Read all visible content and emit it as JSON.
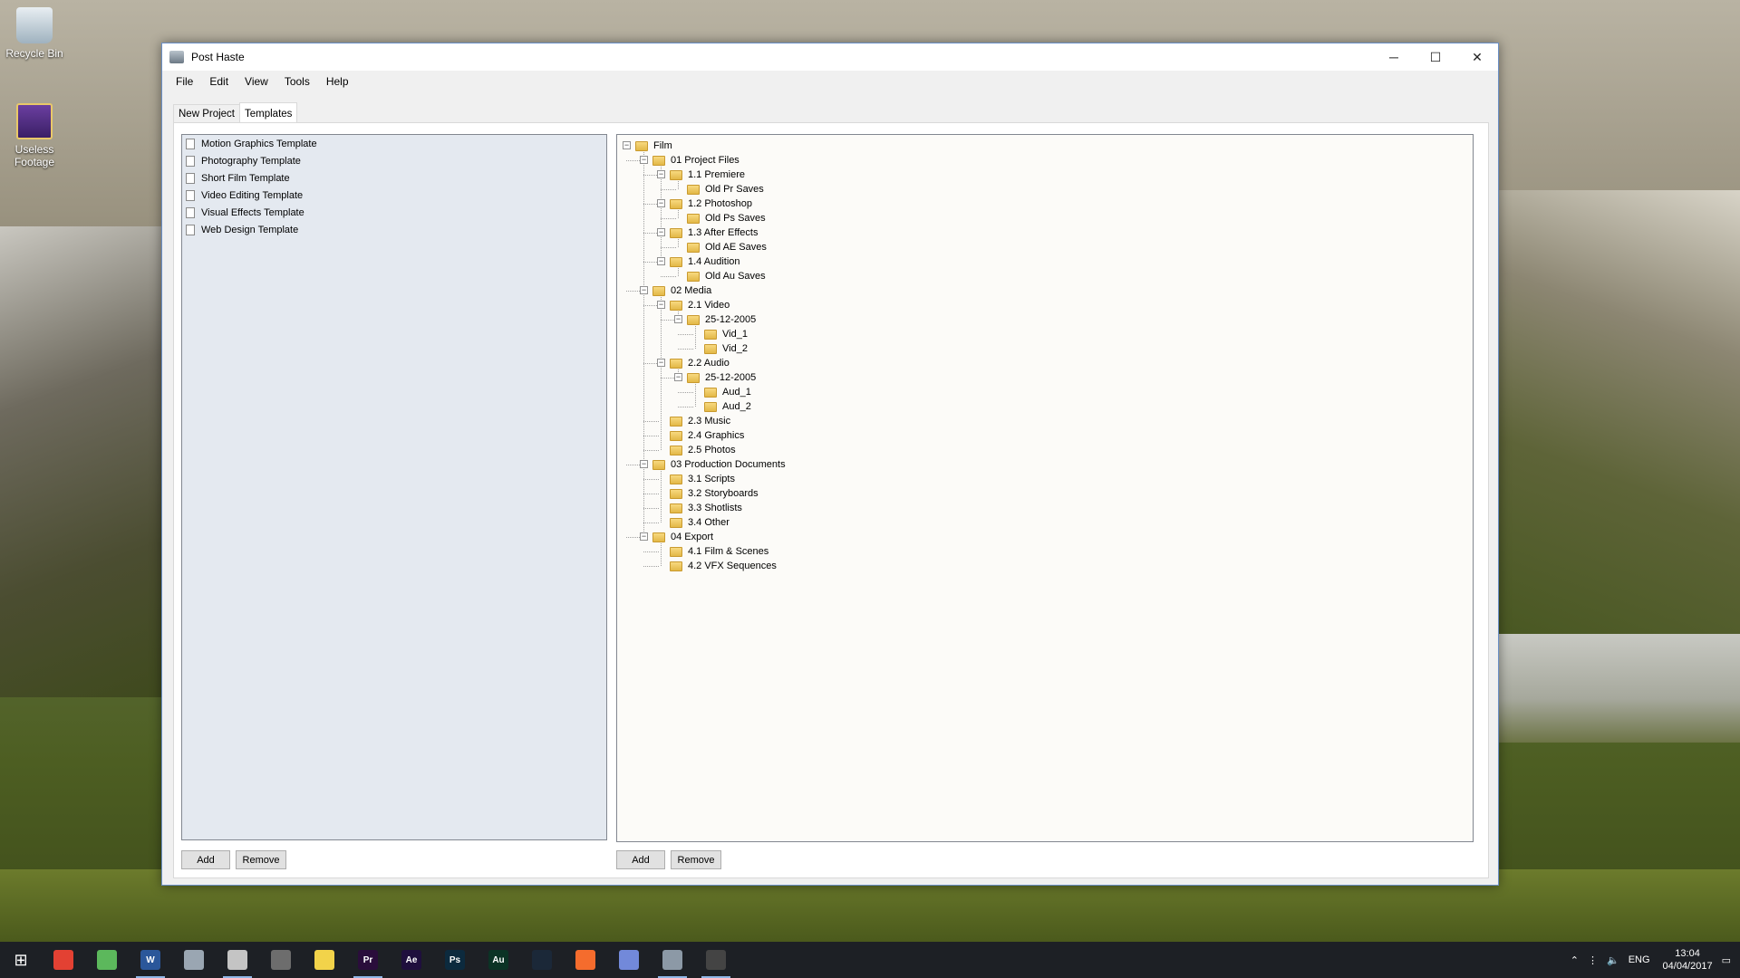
{
  "desktop": {
    "icons": [
      {
        "label": "Recycle Bin"
      },
      {
        "label": "Useless Footage"
      }
    ]
  },
  "window": {
    "title": "Post Haste",
    "controls": {
      "minimize": "─",
      "maximize": "☐",
      "close": "✕"
    },
    "menu": [
      "File",
      "Edit",
      "View",
      "Tools",
      "Help"
    ],
    "tabs": [
      "New Project",
      "Templates"
    ],
    "active_tab": "Templates"
  },
  "templates": [
    "Motion Graphics Template",
    "Photography Template",
    "Short Film Template",
    "Video Editing Template",
    "Visual Effects Template",
    "Web Design Template"
  ],
  "tree": [
    {
      "label": "Film",
      "depth": 0,
      "expanded": true
    },
    {
      "label": "01 Project Files",
      "depth": 1,
      "expanded": true
    },
    {
      "label": "1.1 Premiere",
      "depth": 2,
      "expanded": true
    },
    {
      "label": "Old Pr Saves",
      "depth": 3
    },
    {
      "label": "1.2 Photoshop",
      "depth": 2,
      "expanded": true
    },
    {
      "label": "Old Ps Saves",
      "depth": 3
    },
    {
      "label": "1.3 After Effects",
      "depth": 2,
      "expanded": true
    },
    {
      "label": "Old AE Saves",
      "depth": 3
    },
    {
      "label": "1.4 Audition",
      "depth": 2,
      "expanded": true
    },
    {
      "label": "Old Au Saves",
      "depth": 3
    },
    {
      "label": "02 Media",
      "depth": 1,
      "expanded": true
    },
    {
      "label": "2.1 Video",
      "depth": 2,
      "expanded": true
    },
    {
      "label": "25-12-2005",
      "depth": 3,
      "expanded": true
    },
    {
      "label": "Vid_1",
      "depth": 4
    },
    {
      "label": "Vid_2",
      "depth": 4
    },
    {
      "label": "2.2 Audio",
      "depth": 2,
      "expanded": true
    },
    {
      "label": "25-12-2005",
      "depth": 3,
      "expanded": true
    },
    {
      "label": "Aud_1",
      "depth": 4
    },
    {
      "label": "Aud_2",
      "depth": 4
    },
    {
      "label": "2.3 Music",
      "depth": 2
    },
    {
      "label": "2.4 Graphics",
      "depth": 2
    },
    {
      "label": "2.5 Photos",
      "depth": 2
    },
    {
      "label": "03 Production Documents",
      "depth": 1,
      "expanded": true
    },
    {
      "label": "3.1 Scripts",
      "depth": 2
    },
    {
      "label": "3.2 Storyboards",
      "depth": 2
    },
    {
      "label": "3.3 Shotlists",
      "depth": 2
    },
    {
      "label": "3.4 Other",
      "depth": 2
    },
    {
      "label": "04 Export",
      "depth": 1,
      "expanded": true
    },
    {
      "label": "4.1 Film & Scenes",
      "depth": 2
    },
    {
      "label": "4.2 VFX Sequences",
      "depth": 2
    }
  ],
  "buttons": {
    "templates_add": "Add",
    "templates_remove": "Remove",
    "tree_add": "Add",
    "tree_remove": "Remove"
  },
  "taskbar": {
    "apps": [
      {
        "name": "chrome-icon",
        "text": "",
        "color": "#e34133",
        "running": false
      },
      {
        "name": "clover-icon",
        "text": "",
        "color": "#5cb85c",
        "running": false
      },
      {
        "name": "word-icon",
        "text": "W",
        "color": "#2b579a",
        "running": true
      },
      {
        "name": "explorer-icon",
        "text": "",
        "color": "#9aa6b2",
        "running": false
      },
      {
        "name": "paint-icon",
        "text": "",
        "color": "#c4c4c4",
        "running": true
      },
      {
        "name": "calculator-icon",
        "text": "",
        "color": "#6d6d6d",
        "running": false
      },
      {
        "name": "sticky-notes-icon",
        "text": "",
        "color": "#f2d34a",
        "running": false
      },
      {
        "name": "premiere-icon",
        "text": "Pr",
        "color": "#2a0d3b",
        "running": true
      },
      {
        "name": "after-effects-icon",
        "text": "Ae",
        "color": "#1f0f3d",
        "running": false
      },
      {
        "name": "photoshop-icon",
        "text": "Ps",
        "color": "#0c2a3e",
        "running": false
      },
      {
        "name": "audition-icon",
        "text": "Au",
        "color": "#0b3325",
        "running": false
      },
      {
        "name": "steam-icon",
        "text": "",
        "color": "#1b2838",
        "running": false
      },
      {
        "name": "origin-icon",
        "text": "",
        "color": "#f56c2d",
        "running": false
      },
      {
        "name": "discord-icon",
        "text": "",
        "color": "#7289da",
        "running": false
      },
      {
        "name": "post-haste-icon",
        "text": "",
        "color": "#8c99a6",
        "running": true
      },
      {
        "name": "misc-app-icon",
        "text": "",
        "color": "#444444",
        "running": true
      }
    ],
    "language": "ENG",
    "time": "13:04",
    "date": "04/04/2017"
  }
}
